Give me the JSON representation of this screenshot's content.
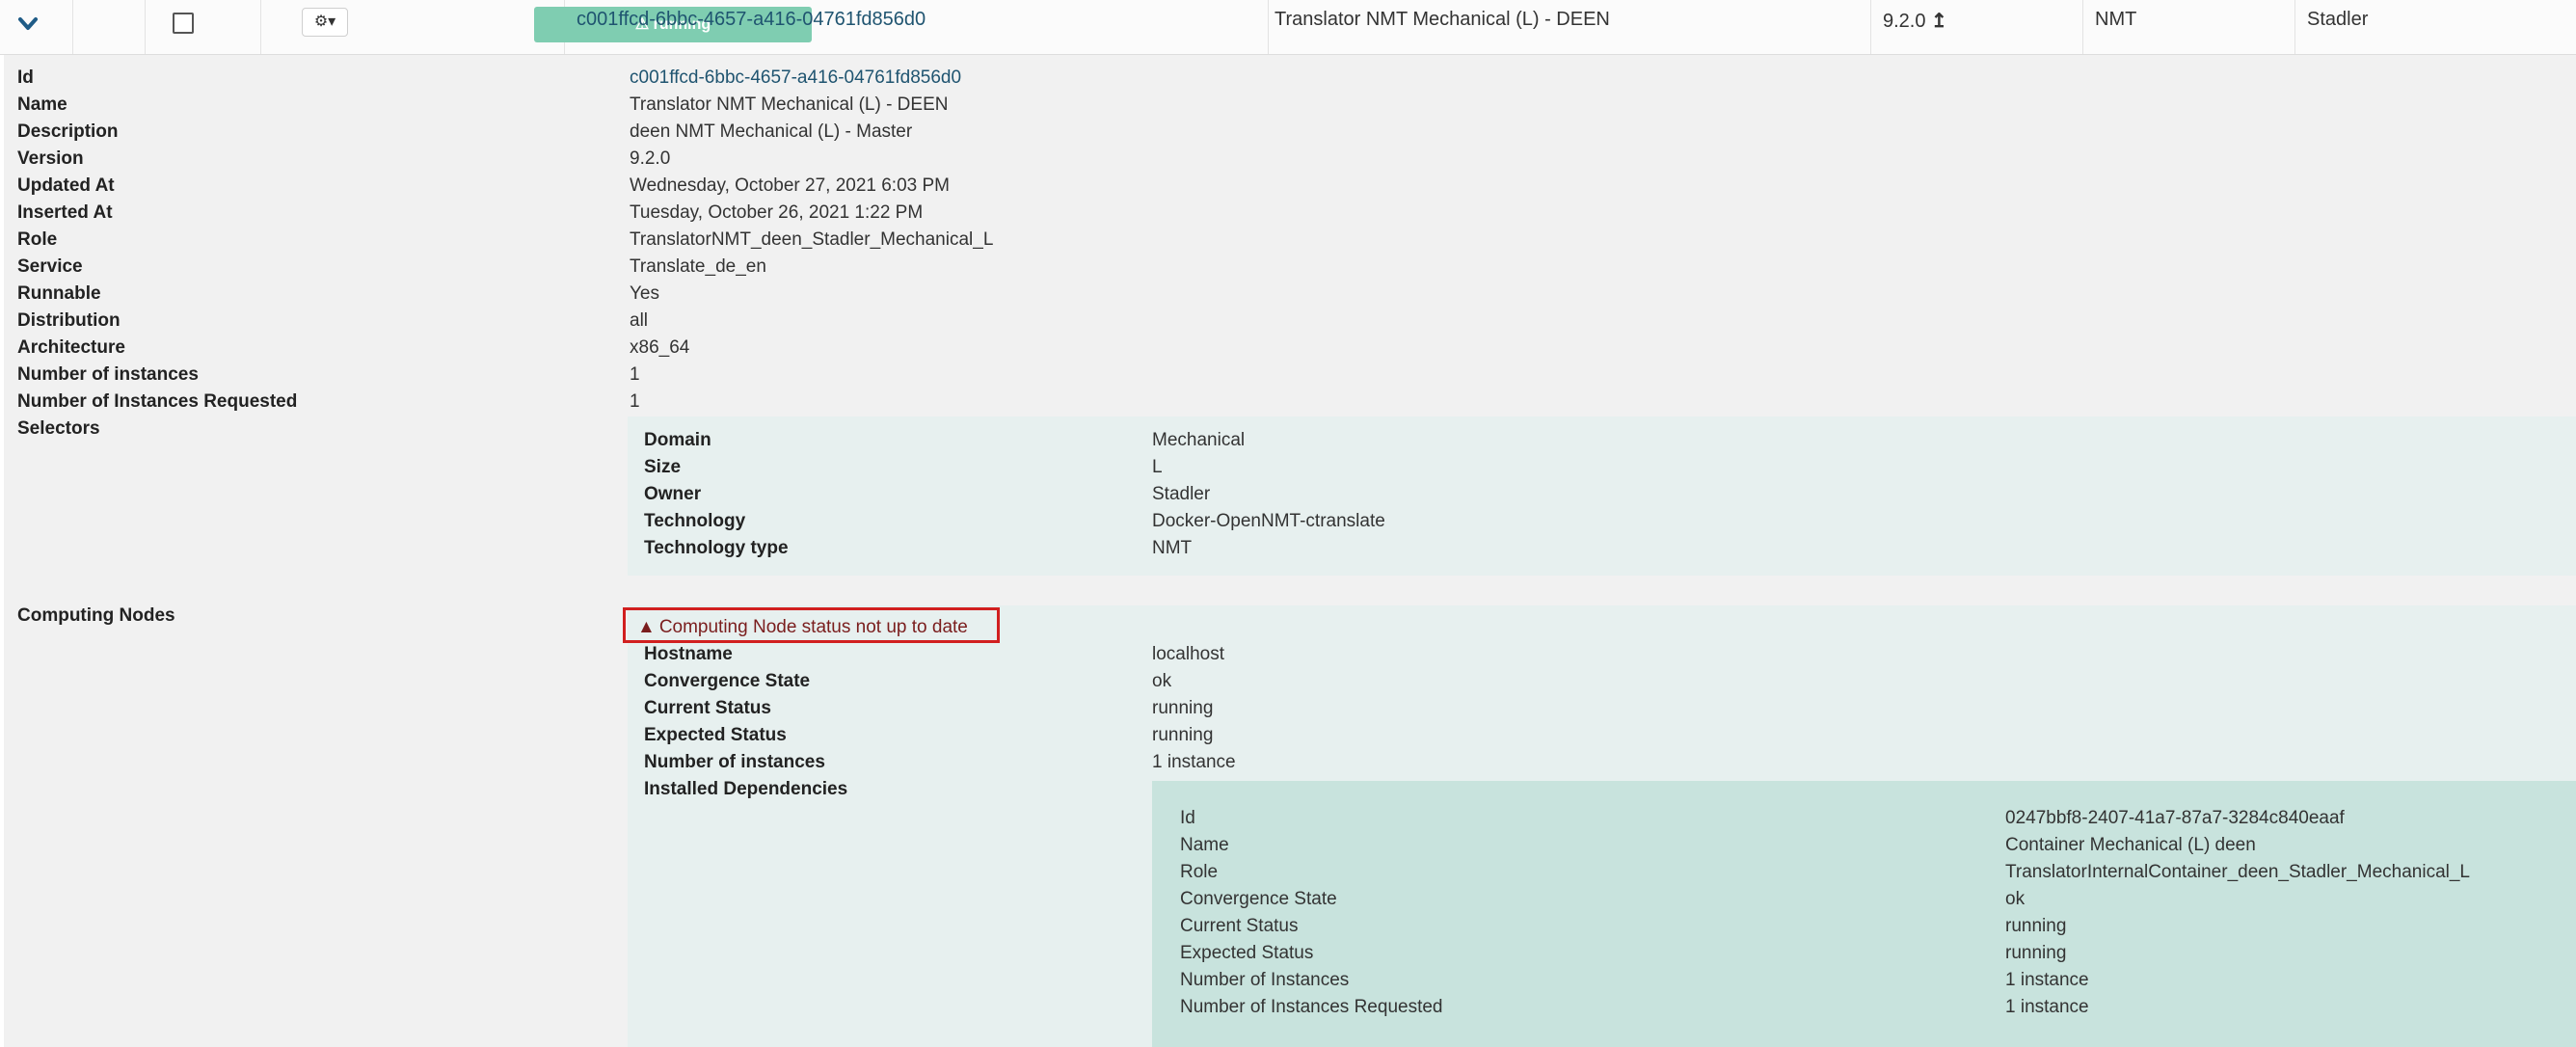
{
  "row": {
    "expand_icon": "chevron-down-icon",
    "gear_icon": "gear-icon",
    "gear_caret": "▾",
    "status": "running",
    "status_icon": "warning-icon",
    "id": "c001ffcd-6bbc-4657-a416-04761fd856d0",
    "name": "Translator NMT Mechanical (L) - DEEN",
    "version": "9.2.0",
    "version_icon": "upgrade-arrow-icon",
    "technology": "NMT",
    "owner": "Stadler"
  },
  "details": [
    {
      "label": "Id",
      "value": "c001ffcd-6bbc-4657-a416-04761fd856d0"
    },
    {
      "label": "Name",
      "value": "Translator NMT Mechanical (L) - DEEN"
    },
    {
      "label": "Description",
      "value": "deen NMT Mechanical (L) - Master"
    },
    {
      "label": "Version",
      "value": "9.2.0"
    },
    {
      "label": "Updated At",
      "value": "Wednesday, October 27, 2021 6:03 PM"
    },
    {
      "label": "Inserted At",
      "value": "Tuesday, October 26, 2021 1:22 PM"
    },
    {
      "label": "Role",
      "value": "TranslatorNMT_deen_Stadler_Mechanical_L"
    },
    {
      "label": "Service",
      "value": "Translate_de_en"
    },
    {
      "label": "Runnable",
      "value": "Yes"
    },
    {
      "label": "Distribution",
      "value": "all"
    },
    {
      "label": "Architecture",
      "value": "x86_64"
    },
    {
      "label": "Number of instances",
      "value": "1"
    },
    {
      "label": "Number of Instances Requested",
      "value": "1"
    },
    {
      "label": "Selectors",
      "value": ""
    }
  ],
  "selectors": [
    {
      "label": "Domain",
      "value": "Mechanical"
    },
    {
      "label": "Size",
      "value": "L"
    },
    {
      "label": "Owner",
      "value": "Stadler"
    },
    {
      "label": "Technology",
      "value": "Docker-OpenNMT-ctranslate"
    },
    {
      "label": "Technology type",
      "value": "NMT"
    }
  ],
  "computing_nodes": {
    "label": "Computing Nodes",
    "warning": "Computing Node status not up to date",
    "warning_icon": "warning-icon",
    "fields": [
      {
        "label": "Hostname",
        "value": "localhost"
      },
      {
        "label": "Convergence State",
        "value": "ok"
      },
      {
        "label": "Current Status",
        "value": "running"
      },
      {
        "label": "Expected Status",
        "value": "running"
      },
      {
        "label": "Number of instances",
        "value": "1 instance"
      },
      {
        "label": "Installed Dependencies",
        "value": ""
      }
    ],
    "dependencies": [
      {
        "label": "Id",
        "value": "0247bbf8-2407-41a7-87a7-3284c840eaaf"
      },
      {
        "label": "Name",
        "value": "Container Mechanical (L) deen"
      },
      {
        "label": "Role",
        "value": "TranslatorInternalContainer_deen_Stadler_Mechanical_L"
      },
      {
        "label": "Convergence State",
        "value": "ok"
      },
      {
        "label": "Current Status",
        "value": "running"
      },
      {
        "label": "Expected Status",
        "value": "running"
      },
      {
        "label": "Number of Instances",
        "value": "1 instance"
      },
      {
        "label": "Number of Instances Requested",
        "value": "1 instance"
      }
    ]
  },
  "colors": {
    "status_badge": "#7fcdb1",
    "link": "#1f5470",
    "warning_border": "#d11f1f",
    "panel_bg": "#e7f0ef",
    "dependency_bg": "#c8e3dd"
  }
}
